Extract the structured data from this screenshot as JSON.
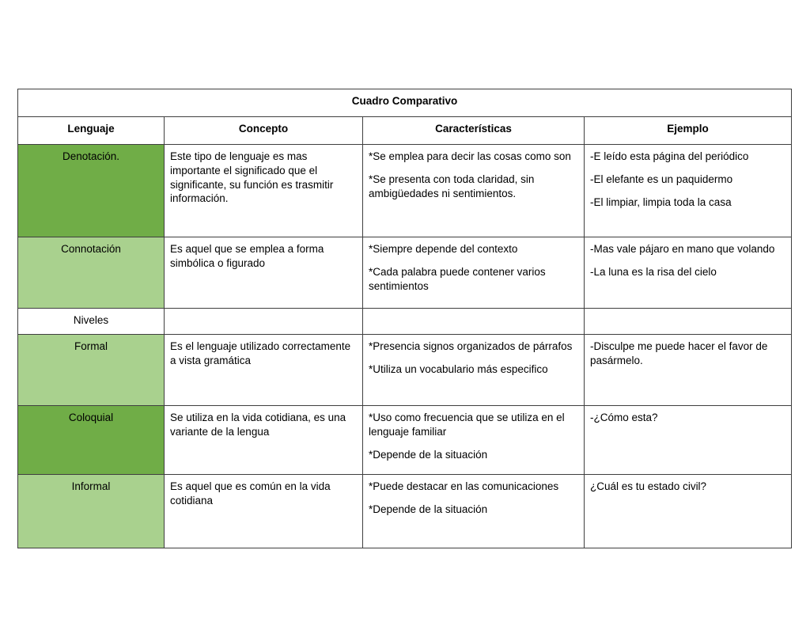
{
  "document": {
    "title": "Cuadro Comparativo"
  },
  "table": {
    "title": "Cuadro Comparativo",
    "columns": [
      "Lenguaje",
      "Concepto",
      "Características",
      "Ejemplo"
    ],
    "colors": {
      "header_dark_green": "#70ad47",
      "header_light_green": "#a9d18e",
      "border": "#3f3f3f",
      "cell_background": "#ffffff",
      "text": "#000000"
    },
    "rows": [
      {
        "lenguaje": "Denotación.",
        "shade": "dark",
        "concepto": [
          "Este tipo de lenguaje es mas importante el significado que el significante, su función es trasmitir información."
        ],
        "caracteristicas": [
          "*Se emplea para decir las cosas como son",
          "*Se presenta con toda claridad, sin ambigüedades ni sentimientos."
        ],
        "ejemplo": [
          "-E leído esta página del periódico",
          "-El elefante es un paquidermo",
          "-El limpiar, limpia toda la casa"
        ]
      },
      {
        "lenguaje": "Connotación",
        "shade": "light",
        "concepto": [
          "Es aquel que se emplea a forma simbólica o figurado"
        ],
        "caracteristicas": [
          "*Siempre depende del contexto",
          "*Cada palabra puede contener varios sentimientos"
        ],
        "ejemplo": [
          "-Mas vale pájaro en mano que volando",
          "-La luna es la risa del cielo"
        ]
      },
      {
        "lenguaje": "Niveles",
        "shade": "divider",
        "concepto": [],
        "caracteristicas": [],
        "ejemplo": []
      },
      {
        "lenguaje": "Formal",
        "shade": "light",
        "concepto": [
          "Es el lenguaje utilizado correctamente a vista gramática"
        ],
        "caracteristicas": [
          "*Presencia signos organizados de párrafos",
          "*Utiliza un vocabulario más especifico"
        ],
        "ejemplo": [
          "-Disculpe me puede hacer el favor de pasármelo."
        ]
      },
      {
        "lenguaje": "Coloquial",
        "shade": "dark",
        "concepto": [
          "Se utiliza en la vida cotidiana, es una variante de la lengua"
        ],
        "caracteristicas": [
          "*Uso como frecuencia que se utiliza en el lenguaje familiar",
          "*Depende de la situación"
        ],
        "ejemplo": [
          "-¿Cómo esta?"
        ]
      },
      {
        "lenguaje": "Informal",
        "shade": "light",
        "concepto": [
          "Es aquel que es común en la vida cotidiana"
        ],
        "caracteristicas": [
          "*Puede destacar en las comunicaciones",
          "*Depende de la situación"
        ],
        "ejemplo": [
          "¿Cuál es tu estado civil?"
        ]
      }
    ]
  }
}
